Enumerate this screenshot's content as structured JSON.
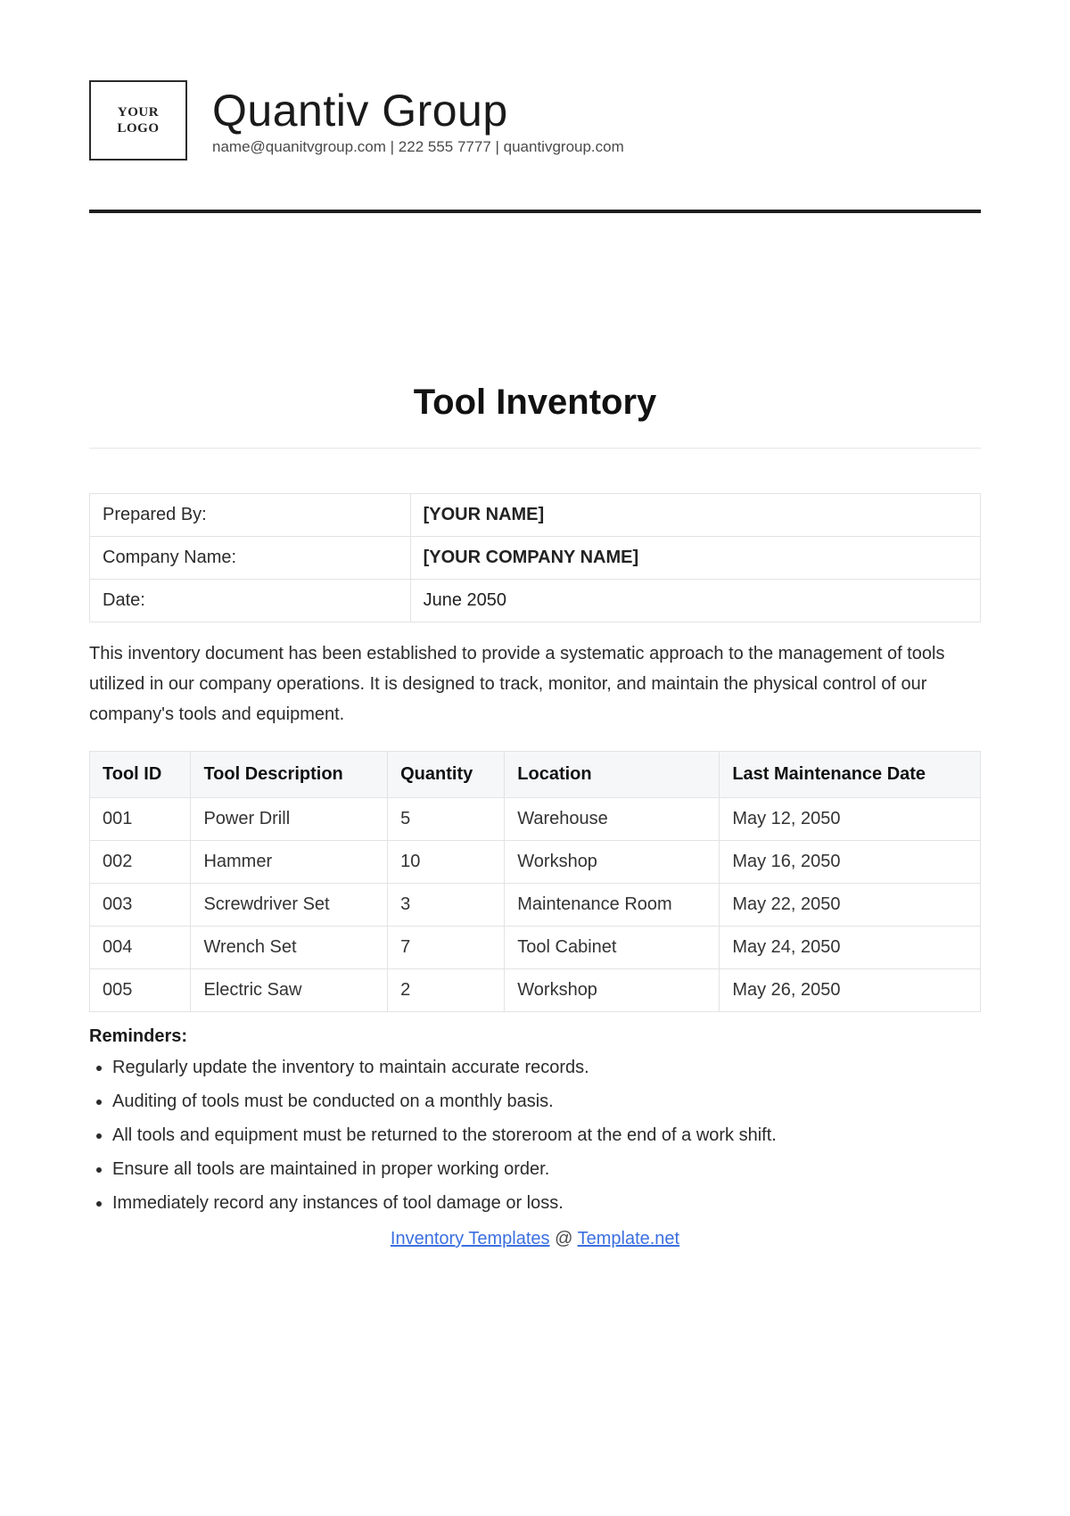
{
  "header": {
    "logo_text": "YOUR\nLOGO",
    "company_name": "Quantiv Group",
    "contact_line": "name@quanitvgroup.com | 222 555 7777 | quantivgroup.com"
  },
  "title": "Tool Inventory",
  "info": [
    {
      "label": "Prepared By:",
      "value": "[YOUR NAME]",
      "bold": true
    },
    {
      "label": "Company Name:",
      "value": "[YOUR COMPANY NAME]",
      "bold": true
    },
    {
      "label": "Date:",
      "value": "June 2050",
      "bold": false
    }
  ],
  "intro": "This inventory document has been established to provide a systematic approach to the management of tools utilized in our company operations. It is designed to track, monitor, and maintain the physical control of our company's tools and equipment.",
  "tools": {
    "headers": [
      "Tool ID",
      "Tool Description",
      "Quantity",
      "Location",
      "Last Maintenance Date"
    ],
    "rows": [
      {
        "id": "001",
        "desc": "Power Drill",
        "qty": "5",
        "loc": "Warehouse",
        "date": "May 12, 2050"
      },
      {
        "id": "002",
        "desc": "Hammer",
        "qty": "10",
        "loc": "Workshop",
        "date": "May 16, 2050"
      },
      {
        "id": "003",
        "desc": "Screwdriver Set",
        "qty": "3",
        "loc": "Maintenance Room",
        "date": "May 22, 2050"
      },
      {
        "id": "004",
        "desc": "Wrench Set",
        "qty": "7",
        "loc": "Tool Cabinet",
        "date": "May 24, 2050"
      },
      {
        "id": "005",
        "desc": "Electric Saw",
        "qty": "2",
        "loc": "Workshop",
        "date": "May 26, 2050"
      }
    ]
  },
  "reminders_title": "Reminders:",
  "reminders": [
    "Regularly update the inventory to maintain accurate records.",
    "Auditing of tools must be conducted on a monthly basis.",
    "All tools and equipment must be returned to the storeroom at the end of a work shift.",
    "Ensure all tools are maintained in proper working order.",
    "Immediately record any instances of tool damage or loss."
  ],
  "footer": {
    "link1": "Inventory Templates",
    "at": "@",
    "link2": "Template.net"
  }
}
